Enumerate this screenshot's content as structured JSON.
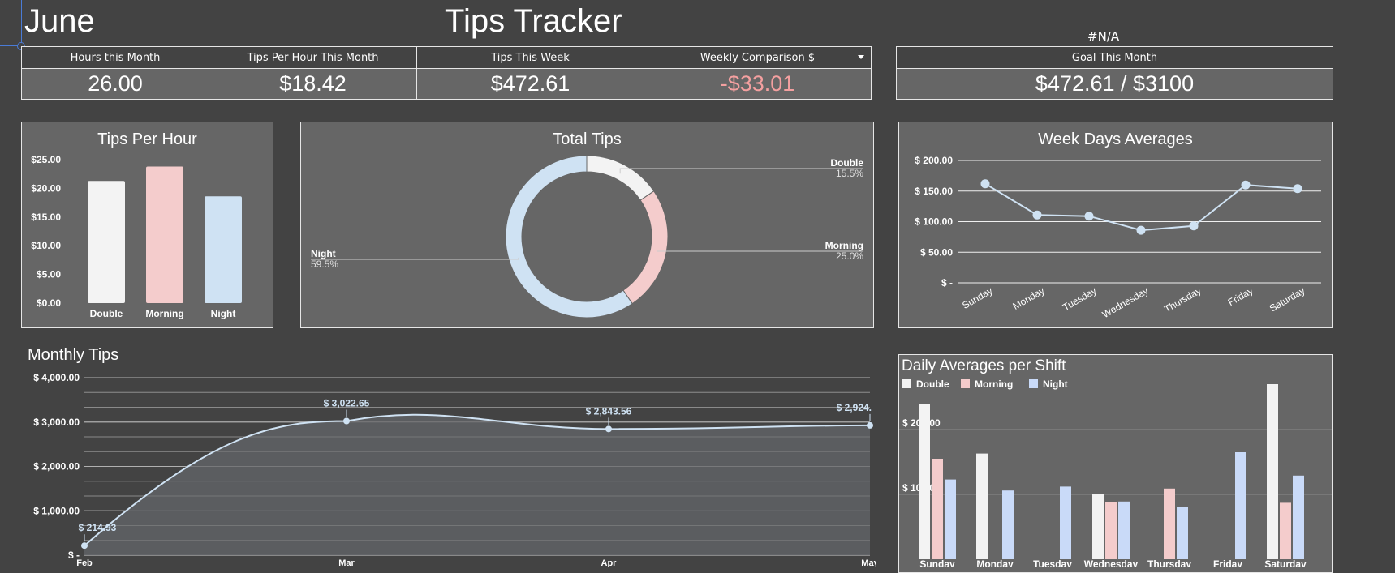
{
  "header": {
    "month": "June",
    "app_title": "Tips Tracker",
    "na_text": "#N/A"
  },
  "stats": [
    {
      "label": "Hours this Month",
      "value": "26.00"
    },
    {
      "label": "Tips Per Hour This Month",
      "value": "$18.42"
    },
    {
      "label": "Tips This Week",
      "value": "$472.61"
    },
    {
      "label": "Weekly Comparison $",
      "value": "-$33.01"
    }
  ],
  "goal": {
    "label": "Goal This Month",
    "value": "$472.61 / $3100"
  },
  "colors": {
    "negative": "#f4a0a0",
    "double": "#f3f3f3",
    "morning": "#f4cccc",
    "night": "#cfe2f3",
    "night_daily": "#c9daf8",
    "panel": "#666666",
    "background": "#434343"
  },
  "chart_data": [
    {
      "type": "bar",
      "title": "Tips Per Hour",
      "categories": [
        "Double",
        "Morning",
        "Night"
      ],
      "values": [
        21.3,
        23.8,
        18.6
      ],
      "yticks": [
        "$0.00",
        "$5.00",
        "$10.00",
        "$15.00",
        "$20.00",
        "$25.00"
      ],
      "ylim": [
        0,
        25
      ]
    },
    {
      "type": "pie",
      "title": "Total Tips",
      "donut": true,
      "slices": [
        {
          "label": "Double",
          "pct": "15.5%",
          "value": 15.5
        },
        {
          "label": "Morning",
          "pct": "25.0%",
          "value": 25.0
        },
        {
          "label": "Night",
          "pct": "59.5%",
          "value": 59.5
        }
      ]
    },
    {
      "type": "line",
      "title": "Week Days Averages",
      "categories": [
        "Sunday",
        "Monday",
        "Tuesday",
        "Wednesday",
        "Thursday",
        "Friday",
        "Saturday"
      ],
      "values": [
        162,
        111,
        109,
        86,
        93,
        160,
        154
      ],
      "yticks": [
        "$ -",
        "$ 50.00",
        "$ 100.00",
        "$ 150.00",
        "$ 200.00"
      ],
      "ylim": [
        0,
        200
      ]
    },
    {
      "type": "area",
      "title": "Monthly Tips",
      "categories": [
        "Feb",
        "Mar",
        "Apr",
        "May"
      ],
      "values": [
        214.93,
        3022.65,
        2843.56,
        2924
      ],
      "labels": [
        "$ 214.93",
        "$ 3,022.65",
        "$ 2,843.56",
        "$ 2,924."
      ],
      "yticks": [
        "$ -",
        "$ 1,000.00",
        "$ 2,000.00",
        "$ 3,000.00",
        "$ 4,000.00"
      ],
      "ylim": [
        0,
        4000
      ]
    },
    {
      "type": "bar",
      "title": "Daily Averages per Shift",
      "categories": [
        "Sunday",
        "Monday",
        "Tuesday",
        "Wednesday",
        "Thursday",
        "Friday",
        "Saturday"
      ],
      "series": [
        {
          "name": "Double",
          "values": [
            240,
            163,
            0,
            101,
            0,
            0,
            270
          ]
        },
        {
          "name": "Morning",
          "values": [
            155,
            0,
            0,
            88,
            109,
            0,
            87
          ]
        },
        {
          "name": "Night",
          "values": [
            123,
            106,
            112,
            89,
            81,
            165,
            129
          ]
        }
      ],
      "yticks": [
        "$ 100.00",
        "$ 200.00"
      ],
      "ylim": [
        0,
        270
      ]
    }
  ]
}
